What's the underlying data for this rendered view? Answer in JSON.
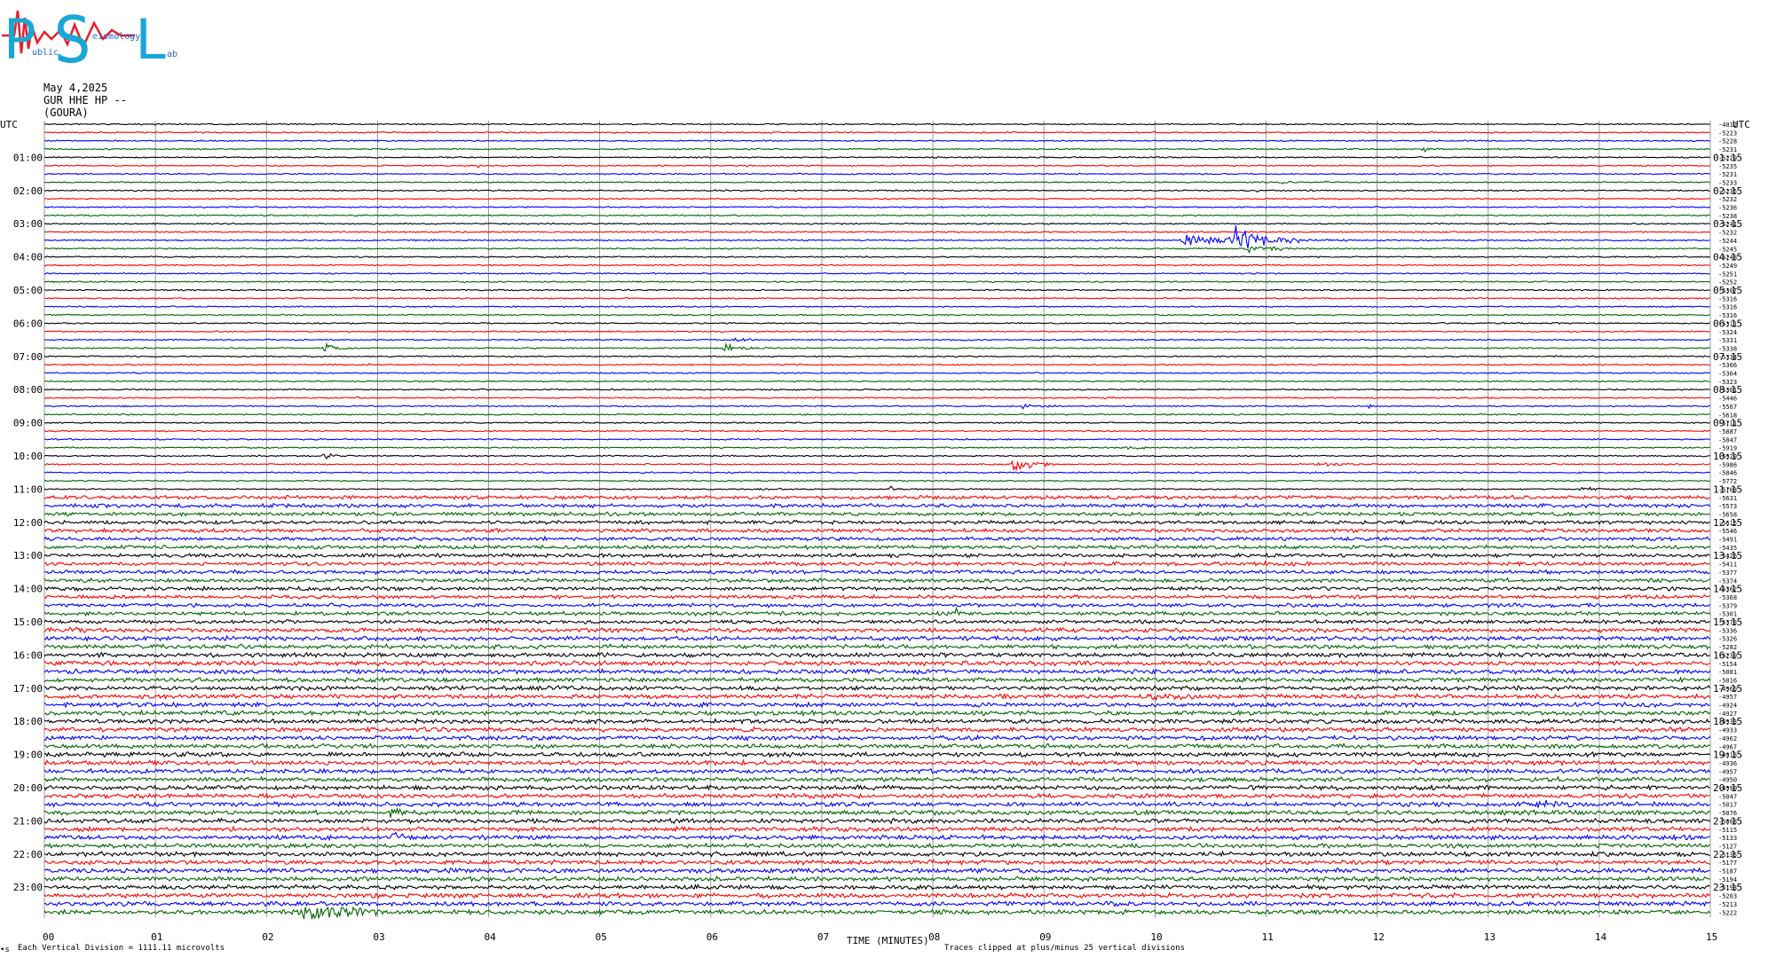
{
  "logo": {
    "letters": [
      "P",
      "S",
      "L"
    ],
    "sub1": "ublic",
    "sub2": "eismology",
    "sub3": "ab",
    "colors": {
      "letters": "#1aa7d6",
      "trace": "#e8202a",
      "small": "#2b62c7"
    }
  },
  "header": {
    "date": "May 4,2025",
    "station": "GUR HHE HP --",
    "site": "(GOURA)"
  },
  "axis": {
    "left_title": "UTC",
    "right_title": "UTC",
    "left_hours": [
      "01:00",
      "02:00",
      "03:00",
      "04:00",
      "05:00",
      "06:00",
      "07:00",
      "08:00",
      "09:00",
      "10:00",
      "11:00",
      "12:00",
      "13:00",
      "14:00",
      "15:00",
      "16:00",
      "17:00",
      "18:00",
      "19:00",
      "20:00",
      "21:00",
      "22:00",
      "23:00"
    ],
    "right_hours": [
      "01:15",
      "02:15",
      "03:15",
      "04:15",
      "05:15",
      "06:15",
      "07:15",
      "08:15",
      "09:15",
      "10:15",
      "11:15",
      "12:15",
      "13:15",
      "14:15",
      "15:15",
      "16:15",
      "17:15",
      "18:15",
      "19:15",
      "20:15",
      "21:15",
      "22:15",
      "23:15"
    ],
    "x_ticks": [
      "00",
      "01",
      "02",
      "03",
      "04",
      "05",
      "06",
      "07",
      "08",
      "09",
      "10",
      "11",
      "12",
      "13",
      "14",
      "15"
    ],
    "x_label": "TIME (MINUTES)"
  },
  "footer": {
    "corner": "•s",
    "division": "Each Vertical Division = 1111.11 microvolts",
    "clip_note": "Traces clipped at plus/minus 25 vertical divisions"
  },
  "chart_data": {
    "type": "line",
    "title": "",
    "xlabel": "TIME (MINUTES)",
    "xlim": [
      0,
      15
    ],
    "trace_count": 96,
    "minutes_per_trace": 15,
    "trace_colors": [
      "#000000",
      "#ff0000",
      "#0000ff",
      "#006400"
    ],
    "grid": "vertical lines at each minute",
    "right_trace_values": [
      "-4012",
      "-5223",
      "-5228",
      "-5231",
      "-5229",
      "-5235",
      "-5231",
      "-5233",
      "-5235",
      "-5232",
      "-5236",
      "-5238",
      "-5241",
      "-5232",
      "-5244",
      "-5245",
      "-5248",
      "-5249",
      "-5251",
      "-5252",
      "-5307",
      "-5316",
      "-5316",
      "-5316",
      "-5311",
      "-5324",
      "-5331",
      "-5338",
      "-5334",
      "-5366",
      "-5364",
      "-5323",
      "-5301",
      "-5446",
      "-5567",
      "-5618",
      "-5711",
      "-5887",
      "-5847",
      "-5919",
      "-5929",
      "-5986",
      "-5846",
      "-5772",
      "-5703",
      "-5631",
      "-5573",
      "-5658",
      "-5615",
      "-5546",
      "-5491",
      "-5435",
      "-5426",
      "-5411",
      "-5377",
      "-5374",
      "-5362",
      "-5368",
      "-5379",
      "-5301",
      "-5373",
      "-5336",
      "-5326",
      "-5282",
      "-5239",
      "-5154",
      "-5081",
      "-5016",
      "-4960",
      "-4957",
      "-4924",
      "-4927",
      "-4933",
      "-4933",
      "-4962",
      "-4967",
      "-4913",
      "-4936",
      "-4957",
      "-4950",
      "-4999",
      "-5047",
      "-5017",
      "-5076",
      "-5068",
      "-5115",
      "-5133",
      "-5127",
      "-5135",
      "-5177",
      "-5187",
      "-5194",
      "-5193",
      "-5203",
      "-5213",
      "-5222"
    ],
    "events": [
      {
        "trace": 0,
        "minute": 12.2,
        "amp": 2.0,
        "dur": 0.6
      },
      {
        "trace": 3,
        "minute": 12.4,
        "amp": 4.5,
        "dur": 0.3
      },
      {
        "trace": 5,
        "minute": 3.9,
        "amp": 3.5,
        "dur": 0.1
      },
      {
        "trace": 5,
        "minute": 6.3,
        "amp": 2.0,
        "dur": 0.4
      },
      {
        "trace": 7,
        "minute": 11.1,
        "amp": 5.0,
        "dur": 0.25
      },
      {
        "trace": 7,
        "minute": 11.5,
        "amp": 4.0,
        "dur": 0.25
      },
      {
        "trace": 8,
        "minute": 10.9,
        "amp": 2.0,
        "dur": 0.3
      },
      {
        "trace": 13,
        "minute": 8.8,
        "amp": 3.0,
        "dur": 0.3
      },
      {
        "trace": 14,
        "minute": 10.2,
        "amp": 9.0,
        "dur": 1.6
      },
      {
        "trace": 14,
        "minute": 10.7,
        "amp": 26.0,
        "dur": 0.6
      },
      {
        "trace": 15,
        "minute": 10.8,
        "amp": 6.0,
        "dur": 1.0
      },
      {
        "trace": 16,
        "minute": 4.5,
        "amp": 2.0,
        "dur": 0.8
      },
      {
        "trace": 16,
        "minute": 13.5,
        "amp": 2.0,
        "dur": 0.2
      },
      {
        "trace": 24,
        "minute": 13.6,
        "amp": 2.5,
        "dur": 0.3
      },
      {
        "trace": 26,
        "minute": 6.2,
        "amp": 4.0,
        "dur": 0.5
      },
      {
        "trace": 26,
        "minute": 13.9,
        "amp": 3.5,
        "dur": 0.2
      },
      {
        "trace": 27,
        "minute": 2.5,
        "amp": 9.0,
        "dur": 0.3
      },
      {
        "trace": 27,
        "minute": 6.1,
        "amp": 9.0,
        "dur": 0.4
      },
      {
        "trace": 29,
        "minute": 2.9,
        "amp": 2.5,
        "dur": 0.2
      },
      {
        "trace": 33,
        "minute": 2.8,
        "amp": 3.0,
        "dur": 0.2
      },
      {
        "trace": 33,
        "minute": 9.5,
        "amp": 3.5,
        "dur": 0.5
      },
      {
        "trace": 34,
        "minute": 8.8,
        "amp": 7.0,
        "dur": 0.3
      },
      {
        "trace": 34,
        "minute": 11.9,
        "amp": 4.5,
        "dur": 0.2
      },
      {
        "trace": 39,
        "minute": 9.7,
        "amp": 4.0,
        "dur": 0.6
      },
      {
        "trace": 40,
        "minute": 2.5,
        "amp": 6.0,
        "dur": 0.3
      },
      {
        "trace": 41,
        "minute": 8.7,
        "amp": 18.0,
        "dur": 0.4
      },
      {
        "trace": 41,
        "minute": 11.4,
        "amp": 3.0,
        "dur": 1.2
      },
      {
        "trace": 44,
        "minute": 7.6,
        "amp": 5.0,
        "dur": 0.3
      },
      {
        "trace": 44,
        "minute": 12.7,
        "amp": 5.0,
        "dur": 0.2
      },
      {
        "trace": 44,
        "minute": 13.8,
        "amp": 4.0,
        "dur": 0.6
      },
      {
        "trace": 47,
        "minute": 9.6,
        "amp": 3.5,
        "dur": 0.4
      },
      {
        "trace": 48,
        "minute": 1.0,
        "amp": 5.0,
        "dur": 0.2
      },
      {
        "trace": 48,
        "minute": 5.4,
        "amp": 3.0,
        "dur": 0.4
      },
      {
        "trace": 49,
        "minute": 1.1,
        "amp": 4.0,
        "dur": 0.2
      },
      {
        "trace": 49,
        "minute": 13.8,
        "amp": 3.0,
        "dur": 1.0
      },
      {
        "trace": 56,
        "minute": 3.7,
        "amp": 3.0,
        "dur": 1.0
      },
      {
        "trace": 58,
        "minute": 0.6,
        "amp": 3.0,
        "dur": 0.8
      },
      {
        "trace": 59,
        "minute": 8.2,
        "amp": 10.0,
        "dur": 0.3
      },
      {
        "trace": 60,
        "minute": 10.5,
        "amp": 4.0,
        "dur": 0.2
      },
      {
        "trace": 61,
        "minute": 0.2,
        "amp": 8.0,
        "dur": 0.6
      },
      {
        "trace": 61,
        "minute": 8.9,
        "amp": 3.0,
        "dur": 0.2
      },
      {
        "trace": 64,
        "minute": 6.8,
        "amp": 3.0,
        "dur": 0.4
      },
      {
        "trace": 65,
        "minute": 10.1,
        "amp": 3.0,
        "dur": 0.4
      },
      {
        "trace": 69,
        "minute": 9.9,
        "amp": 7.0,
        "dur": 1.7
      },
      {
        "trace": 71,
        "minute": 0.1,
        "amp": 2.0,
        "dur": 0.3
      },
      {
        "trace": 73,
        "minute": 14.3,
        "amp": 3.0,
        "dur": 0.5
      },
      {
        "trace": 74,
        "minute": 0.0,
        "amp": 3.0,
        "dur": 1.0
      },
      {
        "trace": 76,
        "minute": 2.6,
        "amp": 5.0,
        "dur": 0.1
      },
      {
        "trace": 78,
        "minute": 1.0,
        "amp": 4.0,
        "dur": 0.2
      },
      {
        "trace": 80,
        "minute": 0.0,
        "amp": 2.5,
        "dur": 0.3
      },
      {
        "trace": 82,
        "minute": 13.4,
        "amp": 7.0,
        "dur": 1.5
      },
      {
        "trace": 83,
        "minute": 3.1,
        "amp": 40.0,
        "dur": 0.15
      },
      {
        "trace": 86,
        "minute": 3.1,
        "amp": 12.0,
        "dur": 0.5
      },
      {
        "trace": 89,
        "minute": 8.5,
        "amp": 3.0,
        "dur": 1.0
      },
      {
        "trace": 90,
        "minute": 0.0,
        "amp": 3.0,
        "dur": 15.0
      },
      {
        "trace": 91,
        "minute": 11.5,
        "amp": 4.0,
        "dur": 0.3
      },
      {
        "trace": 92,
        "minute": 11.4,
        "amp": 4.0,
        "dur": 0.3
      },
      {
        "trace": 93,
        "minute": 2.5,
        "amp": 3.0,
        "dur": 1.0
      },
      {
        "trace": 94,
        "minute": 0.0,
        "amp": 3.0,
        "dur": 2.0
      },
      {
        "trace": 94,
        "minute": 5.0,
        "amp": 4.0,
        "dur": 0.4
      },
      {
        "trace": 95,
        "minute": 2.2,
        "amp": 14.0,
        "dur": 2.0
      }
    ]
  }
}
